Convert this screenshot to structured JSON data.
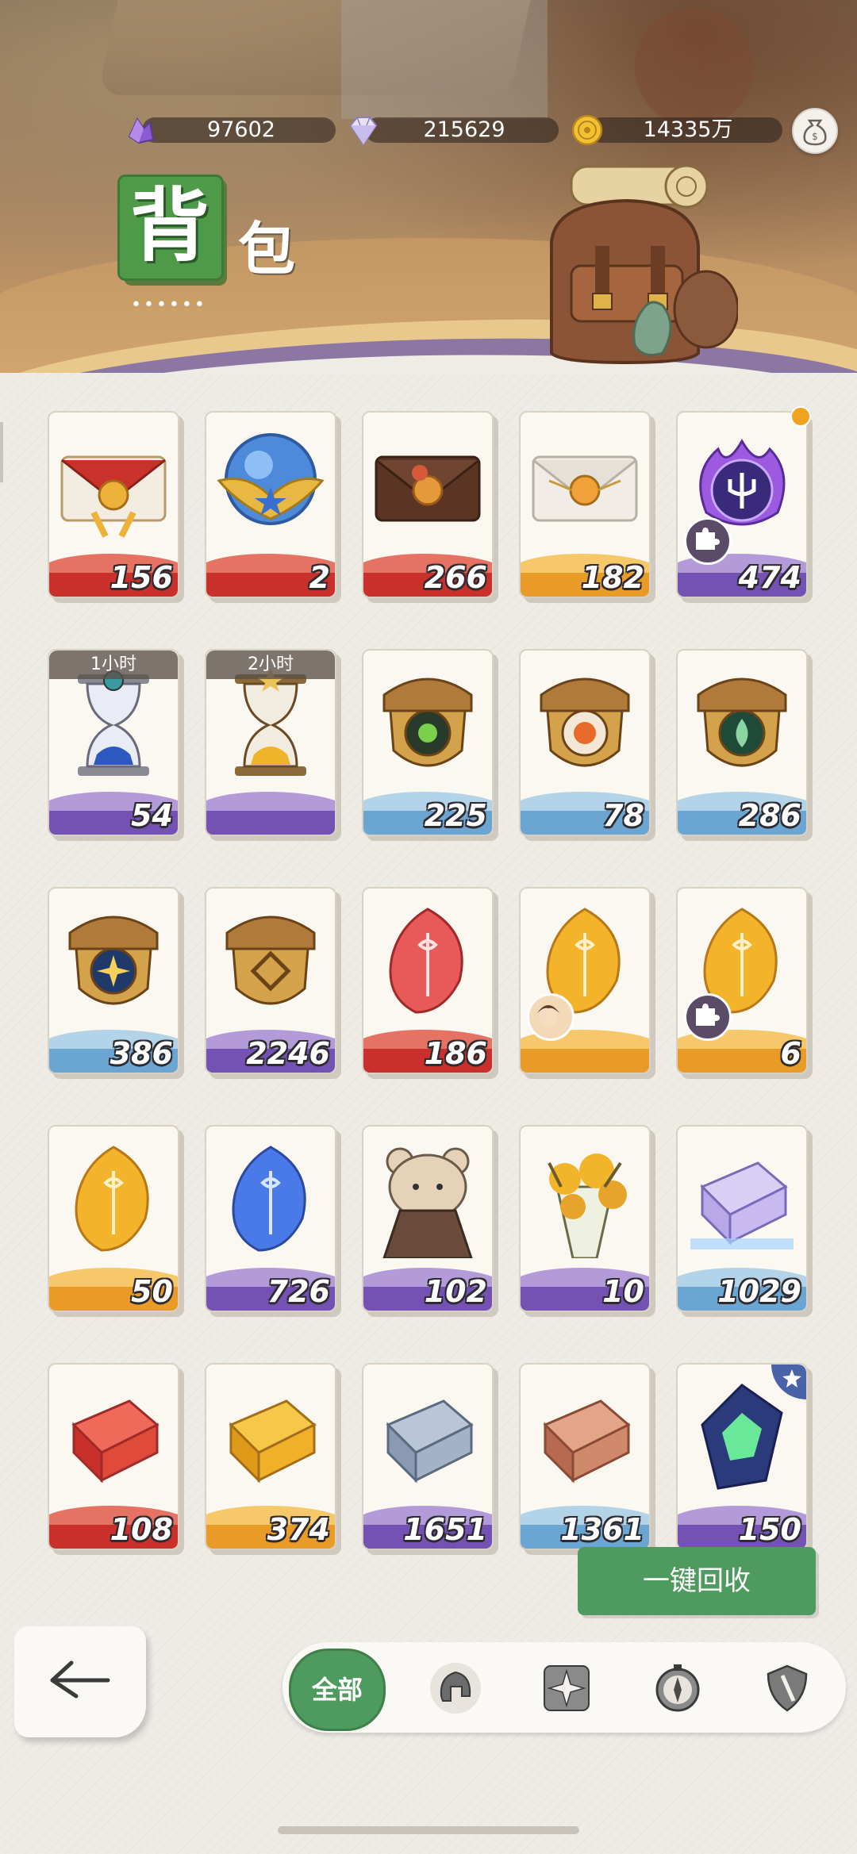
{
  "currencies": [
    {
      "name": "purple-crystal",
      "value": "97602"
    },
    {
      "name": "diamond",
      "value": "215629"
    },
    {
      "name": "gold-coin",
      "value": "14335万"
    }
  ],
  "title": {
    "char1": "背",
    "char2": "包",
    "dots": "••••••"
  },
  "items": [
    {
      "icon": "red-envelope-icon",
      "count": "156",
      "band": "red"
    },
    {
      "icon": "blue-orb-icon",
      "count": "2",
      "band": "red"
    },
    {
      "icon": "brown-envelope-icon",
      "count": "266",
      "band": "red"
    },
    {
      "icon": "white-envelope-icon",
      "count": "182",
      "band": "orange"
    },
    {
      "icon": "purple-trident-orb-icon",
      "count": "474",
      "band": "purple",
      "puzzle": true,
      "dot": true
    },
    {
      "icon": "blue-hourglass-icon",
      "count": "54",
      "band": "purple",
      "timer": "1小时"
    },
    {
      "icon": "gold-hourglass-icon",
      "count": "",
      "band": "purple",
      "timer": "2小时"
    },
    {
      "icon": "acorn-green-eye-icon",
      "count": "225",
      "band": "blue"
    },
    {
      "icon": "acorn-orange-icon",
      "count": "78",
      "band": "blue"
    },
    {
      "icon": "acorn-leaf-icon",
      "count": "286",
      "band": "blue"
    },
    {
      "icon": "acorn-blue-star-icon",
      "count": "386",
      "band": "blue"
    },
    {
      "icon": "acorn-gold-icon",
      "count": "2246",
      "band": "purple"
    },
    {
      "icon": "red-feather-gem-icon",
      "count": "186",
      "band": "red"
    },
    {
      "icon": "gold-feather-gem-icon",
      "count": "",
      "band": "orange",
      "avatar": true
    },
    {
      "icon": "gold-feather-gem-icon",
      "count": "6",
      "band": "orange",
      "puzzle": true
    },
    {
      "icon": "gold-feather-gem-icon",
      "count": "50",
      "band": "orange"
    },
    {
      "icon": "blue-feather-gem-icon",
      "count": "726",
      "band": "purple"
    },
    {
      "icon": "bear-figurine-icon",
      "count": "102",
      "band": "purple"
    },
    {
      "icon": "flower-bouquet-icon",
      "count": "10",
      "band": "purple"
    },
    {
      "icon": "crystal-ingot-icon",
      "count": "1029",
      "band": "blue"
    },
    {
      "icon": "red-ingot-icon",
      "count": "108",
      "band": "red"
    },
    {
      "icon": "gold-ingot-icon",
      "count": "374",
      "band": "orange"
    },
    {
      "icon": "silver-ingot-icon",
      "count": "1651",
      "band": "purple"
    },
    {
      "icon": "copper-ingot-icon",
      "count": "1361",
      "band": "blue"
    },
    {
      "icon": "green-crystal-icon",
      "count": "150",
      "band": "purple",
      "star": true
    }
  ],
  "recycle_label": "一键回收",
  "filters": {
    "all_label": "全部",
    "icons": [
      "helmet-icon",
      "compass-star-icon",
      "compass-icon",
      "shield-icon"
    ]
  },
  "colors": {
    "accent": "#4f9a5e",
    "background": "#efece6"
  }
}
